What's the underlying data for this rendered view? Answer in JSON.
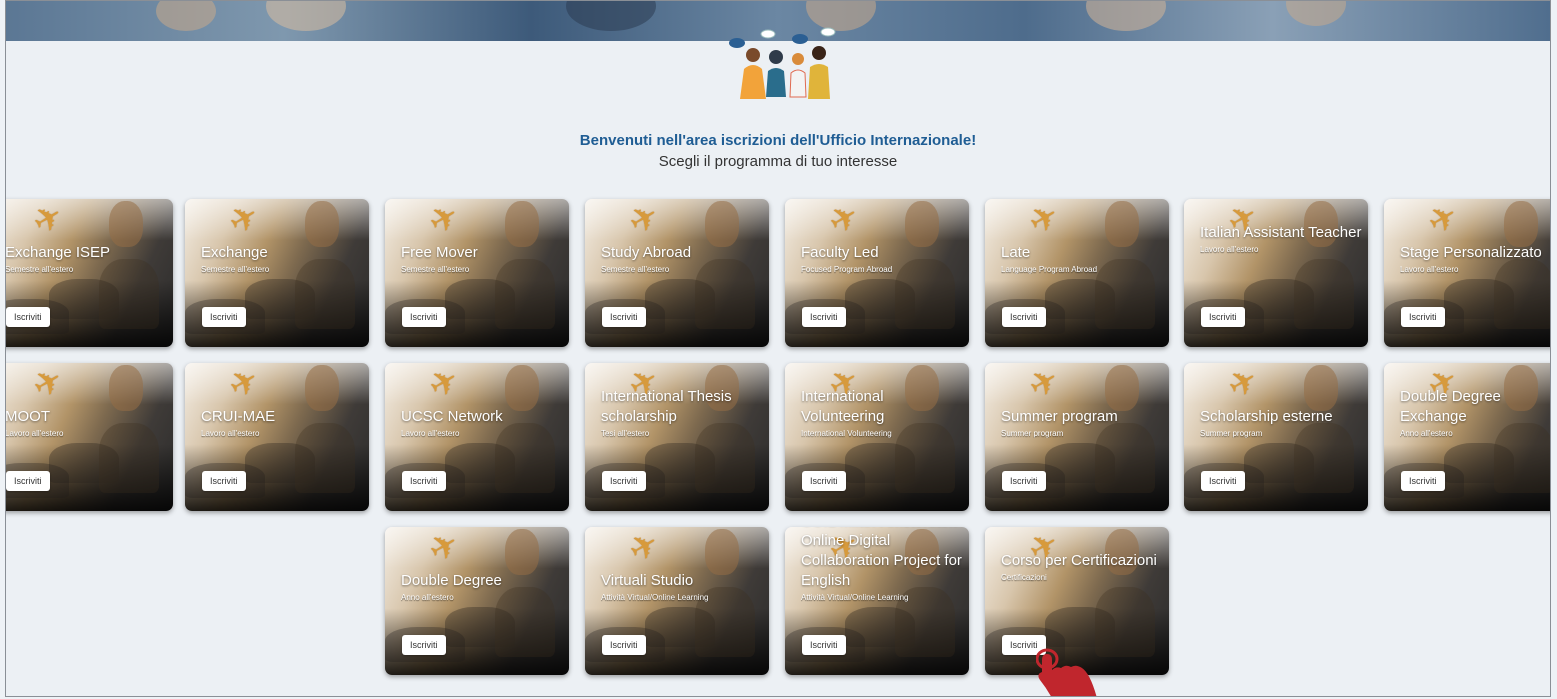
{
  "header": {
    "welcome": "Benvenuti nell'area iscrizioni dell'Ufficio Internazionale!",
    "subtitle": "Scegli il programma di tuo interesse"
  },
  "button_label": "Iscriviti",
  "cards": [
    {
      "title": "Exchange ISEP",
      "subtitle": "Semestre all'estero"
    },
    {
      "title": "Exchange",
      "subtitle": "Semestre all'estero"
    },
    {
      "title": "Free Mover",
      "subtitle": "Semestre all'estero"
    },
    {
      "title": "Study Abroad",
      "subtitle": "Semestre all'estero"
    },
    {
      "title": "Faculty Led",
      "subtitle": "Focused Program Abroad"
    },
    {
      "title": "Late",
      "subtitle": "Language Program Abroad"
    },
    {
      "title": "Italian Assistant Teacher",
      "subtitle": "Lavoro all'estero"
    },
    {
      "title": "Stage Personalizzato",
      "subtitle": "Lavoro all'estero"
    },
    {
      "title": "MOOT",
      "subtitle": "Lavoro all'estero"
    },
    {
      "title": "CRUI-MAE",
      "subtitle": "Lavoro all'estero"
    },
    {
      "title": "UCSC Network",
      "subtitle": "Lavoro all'estero"
    },
    {
      "title": "International Thesis scholarship",
      "subtitle": "Tesi all'estero"
    },
    {
      "title": "International Volunteering",
      "subtitle": "International Volunteering"
    },
    {
      "title": "Summer program",
      "subtitle": "Summer program"
    },
    {
      "title": "Scholarship esterne",
      "subtitle": "Summer program"
    },
    {
      "title": "Double Degree Exchange",
      "subtitle": "Anno all'estero"
    },
    {
      "title": "Double Degree",
      "subtitle": "Anno all'estero"
    },
    {
      "title": "Virtuali Studio",
      "subtitle": "Attività Virtual/Online Learning"
    },
    {
      "title": "COIL Milan-Amsterdam Online Digital Collaboration Project for English",
      "subtitle": "Attività Virtual/Online Learning"
    },
    {
      "title": "Corso per Certificazioni",
      "subtitle": "Certificazioni"
    }
  ],
  "colors": {
    "accent": "#1f5d94",
    "plane": "#d79a3c",
    "cursor": "#c0262d"
  },
  "icons": [
    "airplane-icon",
    "hand-pointer-cursor-icon"
  ]
}
